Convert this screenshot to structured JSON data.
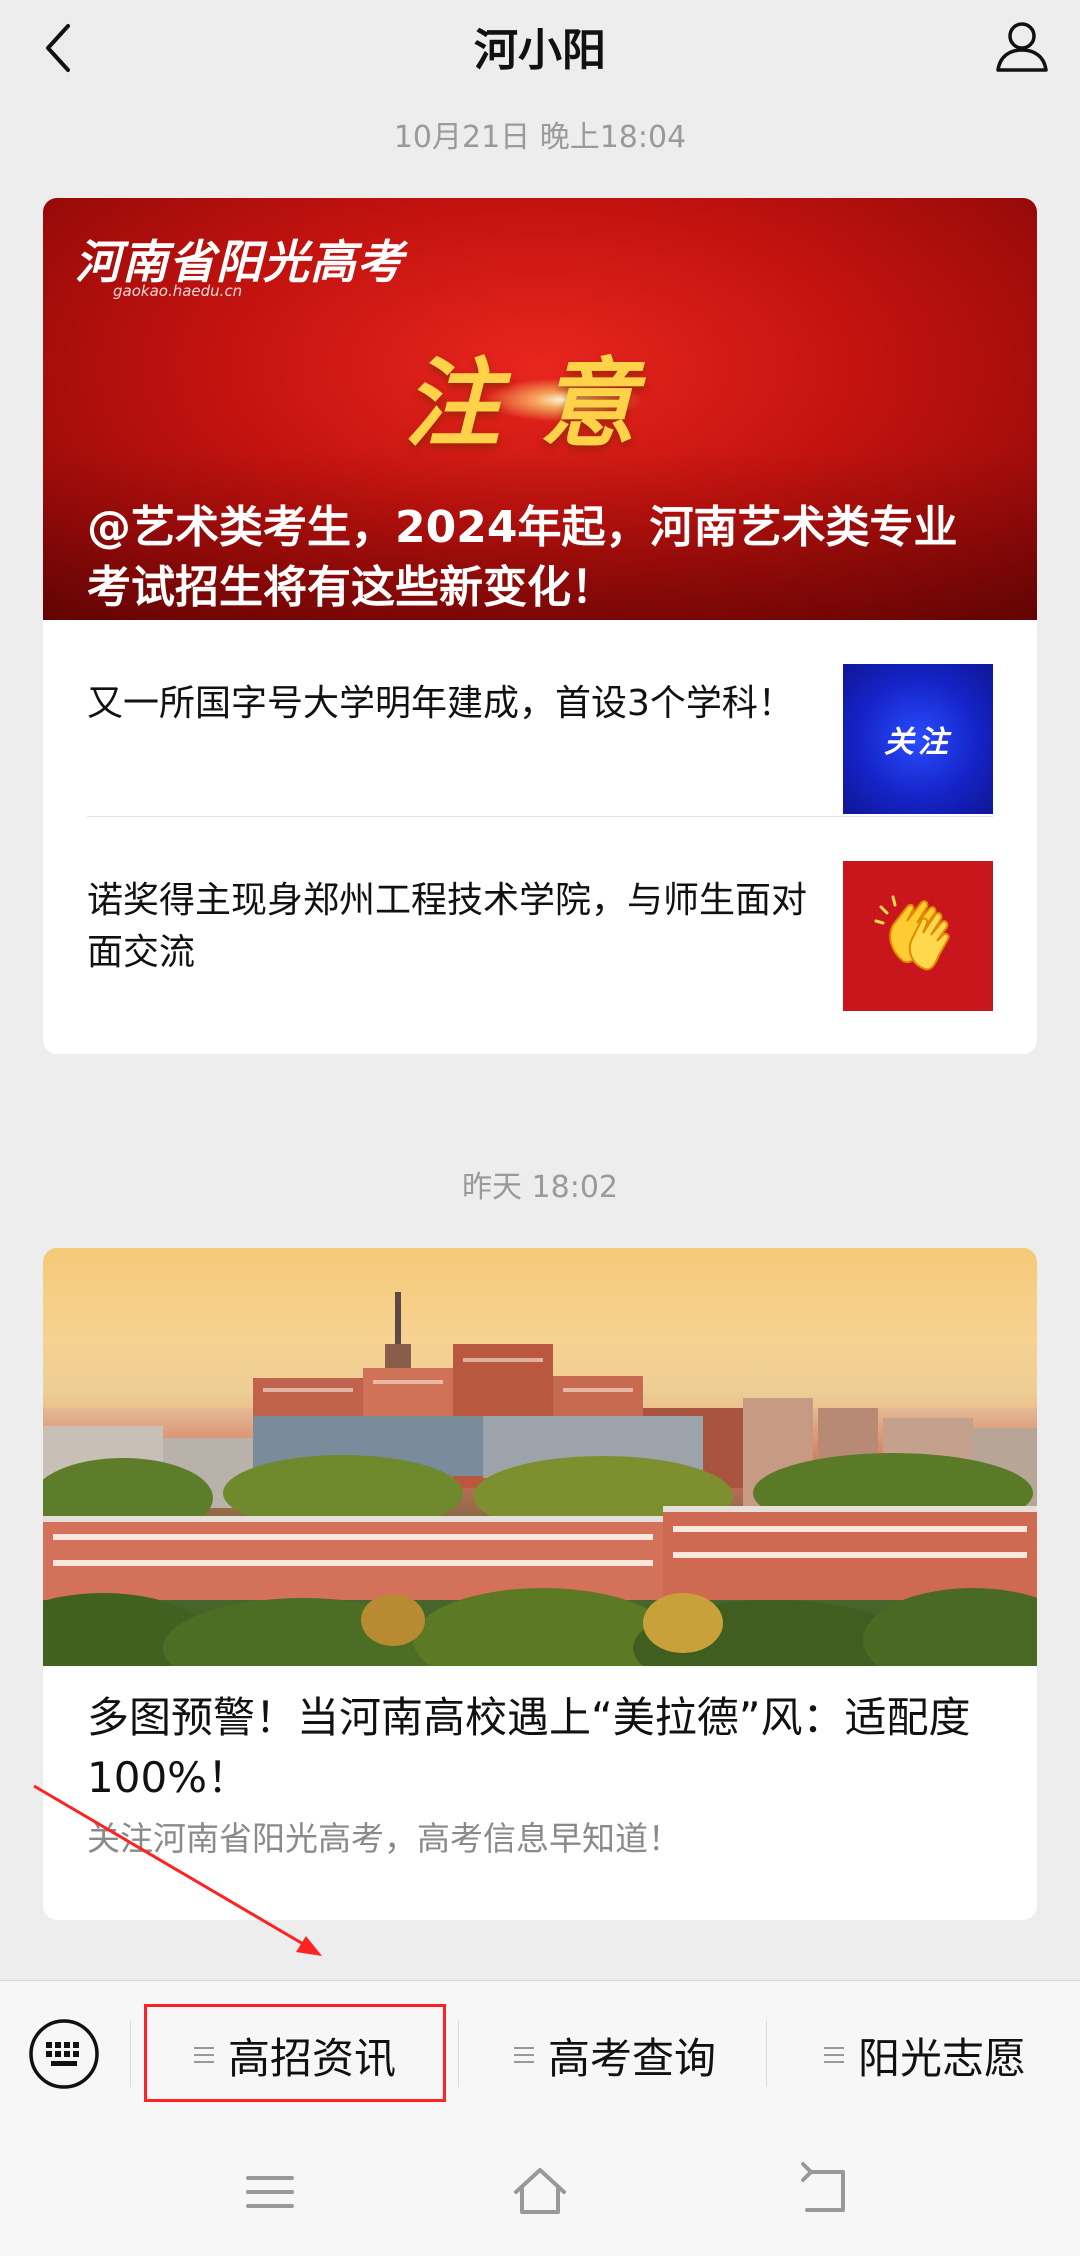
{
  "header": {
    "title": "河小阳"
  },
  "feed": [
    {
      "timestamp": "10月21日 晚上18:04",
      "hero": {
        "brand": "河南省阳光高考",
        "brand_url": "gaokao.haedu.cn",
        "big_word": "注意",
        "headline": "@艺术类考生，2024年起，河南艺术类专业考试招生将有这些新变化！"
      },
      "items": [
        {
          "text": "又一所国字号大学明年建成，首设3个学科！",
          "thumb_text": "关注"
        },
        {
          "text": "诺奖得主现身郑州工程技术学院，与师生面对面交流",
          "thumb_icon": "clapping-hands"
        }
      ]
    },
    {
      "timestamp": "昨天 18:02",
      "title": "多图预警！当河南高校遇上“美拉德”风：适配度100%！",
      "desc": "关注河南省阳光高考，高考信息早知道！"
    }
  ],
  "menu": {
    "items": [
      {
        "label": "高招资讯"
      },
      {
        "label": "高考查询"
      },
      {
        "label": "阳光志愿"
      }
    ]
  },
  "colors": {
    "highlight": "#ff2222",
    "hero_red": "#c4130f"
  }
}
